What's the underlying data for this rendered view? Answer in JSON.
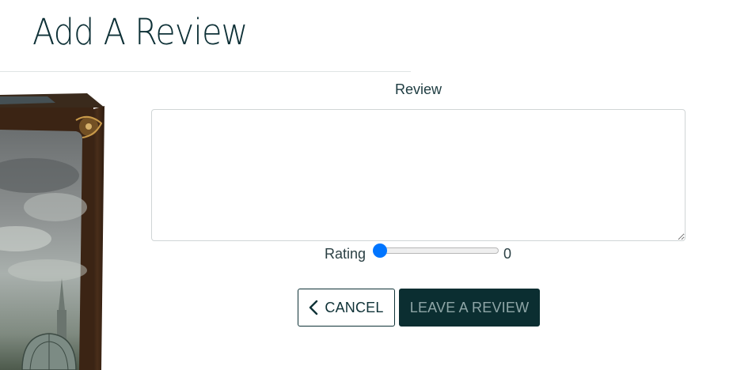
{
  "page": {
    "title": "Add A Review"
  },
  "form": {
    "review_label": "Review",
    "review_value": "",
    "rating_label": "Rating",
    "rating_value": "0",
    "rating_min": 0,
    "rating_max": 5,
    "rating_level": 0
  },
  "buttons": {
    "cancel_label": "CANCEL",
    "submit_label": "LEAVE A REVIEW"
  },
  "icons": {
    "cancel_icon": "chevron-left-icon",
    "image": "game-box-art"
  },
  "colors": {
    "primary_dark": "#0b2e31",
    "submit_text": "#8fa6a7",
    "slider_thumb": "#0075ff",
    "title_text": "#0d3036"
  }
}
